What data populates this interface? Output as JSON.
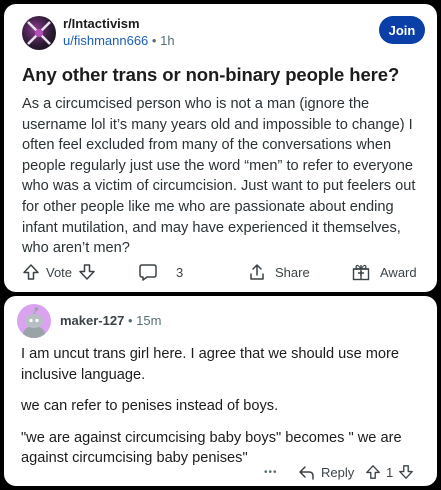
{
  "post": {
    "subreddit": "r/Intactivism",
    "author": "u/fishmann666",
    "separator": "•",
    "age": "1h",
    "join_label": "Join",
    "title": "Any other trans or non-binary people here?",
    "body": "As a circumcised person who is not a man (ignore the username lol it’s many years old and impossible to change) I often feel excluded from many of the conversations when people regularly just use the word “men” to refer to everyone who was a victim of circumcision. Just want to put feelers out for other people like me who are passionate about ending infant mutilation, and may have experienced it themselves, who aren’t men?",
    "actions": {
      "vote_label": "Vote",
      "comment_count": "3",
      "share_label": "Share",
      "award_label": "Award"
    }
  },
  "comment": {
    "author": "maker-127",
    "separator": "•",
    "age": "15m",
    "paragraphs": [
      "I am uncut trans girl here. I agree that we should use more inclusive language.",
      "we can refer to penises instead of boys.",
      "\"we are against circumcising baby boys\" becomes \" we are against circumcising baby penises\""
    ],
    "more": "•••",
    "reply_label": "Reply",
    "score": "1"
  },
  "colors": {
    "join_button": "#0a3fa8",
    "username_link": "#1a5fb4",
    "comment_avatar": "#d9a3f0"
  },
  "icons": [
    "upvote-icon",
    "downvote-icon",
    "comment-bubble-icon",
    "share-icon",
    "award-icon",
    "reply-icon",
    "more-icon"
  ]
}
